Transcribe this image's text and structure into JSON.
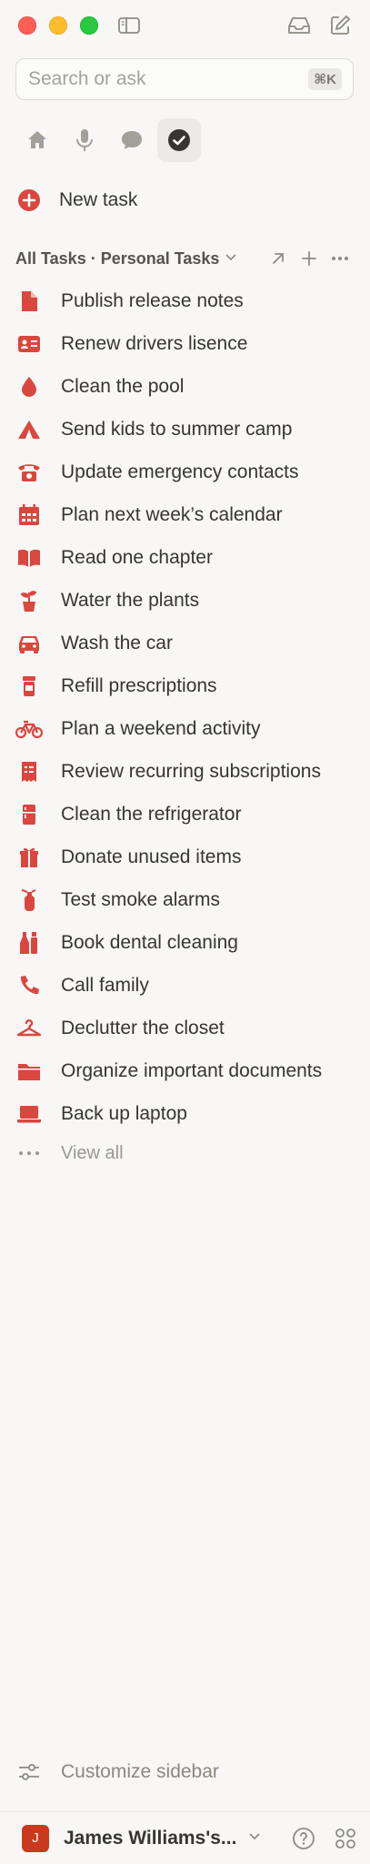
{
  "search": {
    "placeholder": "Search or ask",
    "shortcut": "⌘K"
  },
  "new_task": {
    "label": "New task"
  },
  "section": {
    "title": "All Tasks · Personal Tasks"
  },
  "tasks": [
    {
      "label": "Publish release notes",
      "icon": "document-icon"
    },
    {
      "label": "Renew drivers lisence",
      "icon": "id-card-icon"
    },
    {
      "label": "Clean the pool",
      "icon": "water-drop-icon"
    },
    {
      "label": "Send kids to summer camp",
      "icon": "tent-icon"
    },
    {
      "label": "Update emergency contacts",
      "icon": "phone-icon"
    },
    {
      "label": "Plan next week’s calendar",
      "icon": "calendar-icon"
    },
    {
      "label": "Read one chapter",
      "icon": "book-icon"
    },
    {
      "label": "Water the plants",
      "icon": "plant-icon"
    },
    {
      "label": "Wash the car",
      "icon": "car-icon"
    },
    {
      "label": "Refill prescriptions",
      "icon": "pill-bottle-icon"
    },
    {
      "label": "Plan a weekend activity",
      "icon": "bicycle-icon"
    },
    {
      "label": "Review recurring subscriptions",
      "icon": "receipt-icon"
    },
    {
      "label": "Clean the refrigerator",
      "icon": "fridge-icon"
    },
    {
      "label": "Donate unused items",
      "icon": "gift-icon"
    },
    {
      "label": "Test smoke alarms",
      "icon": "fire-extinguisher-icon"
    },
    {
      "label": "Book dental cleaning",
      "icon": "bottles-icon"
    },
    {
      "label": "Call family",
      "icon": "handset-icon"
    },
    {
      "label": "Declutter the closet",
      "icon": "hanger-icon"
    },
    {
      "label": "Organize important documents",
      "icon": "folder-icon"
    },
    {
      "label": "Back up laptop",
      "icon": "laptop-icon"
    }
  ],
  "view_all": {
    "label": "View all"
  },
  "customize": {
    "label": "Customize sidebar"
  },
  "footer": {
    "avatar_initial": "J",
    "workspace": "James Williams's..."
  },
  "colors": {
    "accent": "#d9473f",
    "background": "#f8f7f5"
  }
}
